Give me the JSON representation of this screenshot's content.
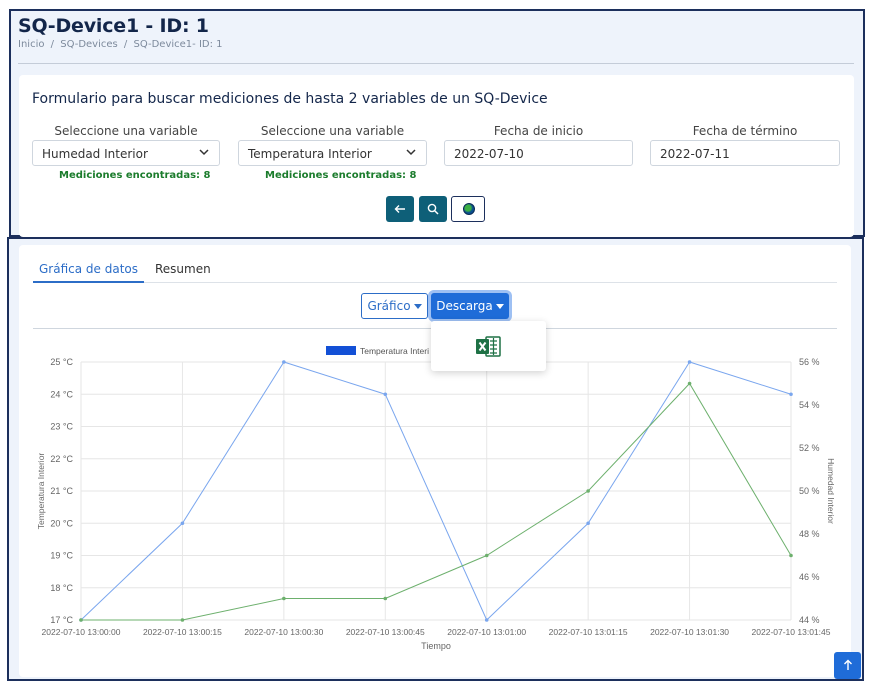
{
  "header": {
    "title": "SQ-Device1 - ID: 1",
    "breadcrumb": [
      "Inicio",
      "/",
      "SQ-Devices",
      "/",
      "SQ-Device1- ID: 1"
    ]
  },
  "form": {
    "title": "Formulario para buscar mediciones de hasta 2 variables de un SQ-Device",
    "var1_label": "Seleccione una variable",
    "var1_value": "Humedad Interior",
    "var1_found": "Mediciones encontradas: 8",
    "var2_label": "Seleccione una variable",
    "var2_value": "Temperatura Interior",
    "var2_found": "Mediciones encontradas: 8",
    "start_label": "Fecha de inicio",
    "start_value": "2022-07-10",
    "end_label": "Fecha de término",
    "end_value": "2022-07-11",
    "icons": {
      "back": "arrow-left-icon",
      "search": "search-icon",
      "map": "globe-icon"
    }
  },
  "tabs": {
    "active": "Gráfica de datos",
    "other": "Resumen"
  },
  "toolbar": {
    "chart_label": "Gráfico",
    "download_label": "Descarga",
    "download_menu_icon": "excel-icon"
  },
  "chart_data": {
    "type": "line",
    "x": [
      "2022-07-10 13:00:00",
      "2022-07-10 13:00:15",
      "2022-07-10 13:00:30",
      "2022-07-10 13:00:45",
      "2022-07-10 13:01:00",
      "2022-07-10 13:01:15",
      "2022-07-10 13:01:30",
      "2022-07-10 13:01:45"
    ],
    "series": [
      {
        "name": "Temperatura Interior",
        "axis": "left",
        "color": "#7aa6ee",
        "values": [
          17,
          20,
          25,
          24,
          17,
          20,
          25,
          24
        ]
      },
      {
        "name": "Humedad Interior",
        "axis": "right",
        "color": "#6db06d",
        "values": [
          44,
          44,
          45,
          45,
          47,
          50,
          55,
          47
        ]
      }
    ],
    "legend_visible": "Temperatura Interi",
    "legend_color": "#1350d6",
    "y_left": {
      "label": "Temperatura Interior",
      "ticks": [
        "17 °C",
        "18 °C",
        "19 °C",
        "20 °C",
        "21 °C",
        "22 °C",
        "23 °C",
        "24 °C",
        "25 °C"
      ],
      "range": [
        17,
        25
      ]
    },
    "y_right": {
      "label": "Humedad Interior",
      "ticks": [
        "44 %",
        "46 %",
        "48 %",
        "50 %",
        "52 %",
        "54 %",
        "56 %"
      ],
      "range": [
        44,
        56
      ]
    },
    "xlabel": "Tiempo",
    "grid": true
  },
  "scroll_top_icon": "arrow-up-icon"
}
